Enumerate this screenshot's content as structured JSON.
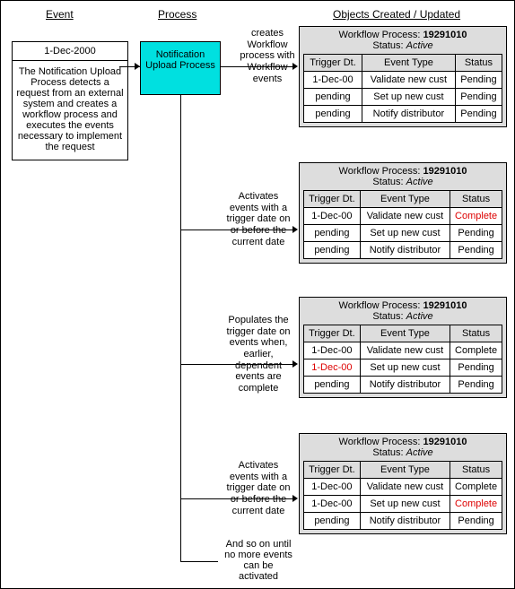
{
  "headers": {
    "event": "Event",
    "process": "Process",
    "objects": "Objects Created / Updated"
  },
  "event": {
    "date": "1-Dec-2000",
    "desc": "The Notification Upload Process detects a request from an external system and creates a workflow process and executes the events necessary to implement the request"
  },
  "process": {
    "name": "Notification Upload Process"
  },
  "notes": {
    "n1": "creates Workflow process with Workflow events",
    "n2": "Activates events with a trigger date on or before the current date",
    "n3": "Populates the trigger date on events when, earlier, dependent events are complete",
    "n4": "Activates events with a trigger date on or before the current date",
    "final": "And so on until no more events can be activated"
  },
  "wf": {
    "proc_label": "Workflow Process",
    "proc_id": "19291010",
    "status_label": "Status",
    "status": "Active",
    "cols": {
      "c1": "Trigger Dt.",
      "c2": "Event Type",
      "c3": "Status"
    }
  },
  "tables": {
    "t1": [
      [
        "1-Dec-00",
        "Validate new cust",
        "Pending"
      ],
      [
        "pending",
        "Set up new cust",
        "Pending"
      ],
      [
        "pending",
        "Notify distributor",
        "Pending"
      ]
    ],
    "t2": [
      [
        "1-Dec-00",
        "Validate new cust",
        "Complete"
      ],
      [
        "pending",
        "Set up new cust",
        "Pending"
      ],
      [
        "pending",
        "Notify distributor",
        "Pending"
      ]
    ],
    "t3": [
      [
        "1-Dec-00",
        "Validate new cust",
        "Complete"
      ],
      [
        "1-Dec-00",
        "Set up new cust",
        "Pending"
      ],
      [
        "pending",
        "Notify distributor",
        "Pending"
      ]
    ],
    "t4": [
      [
        "1-Dec-00",
        "Validate new cust",
        "Complete"
      ],
      [
        "1-Dec-00",
        "Set up new cust",
        "Complete"
      ],
      [
        "pending",
        "Notify distributor",
        "Pending"
      ]
    ]
  },
  "highlights": {
    "t2": [
      [
        0,
        2
      ]
    ],
    "t3": [
      [
        1,
        0
      ]
    ],
    "t4": [
      [
        1,
        2
      ]
    ]
  }
}
